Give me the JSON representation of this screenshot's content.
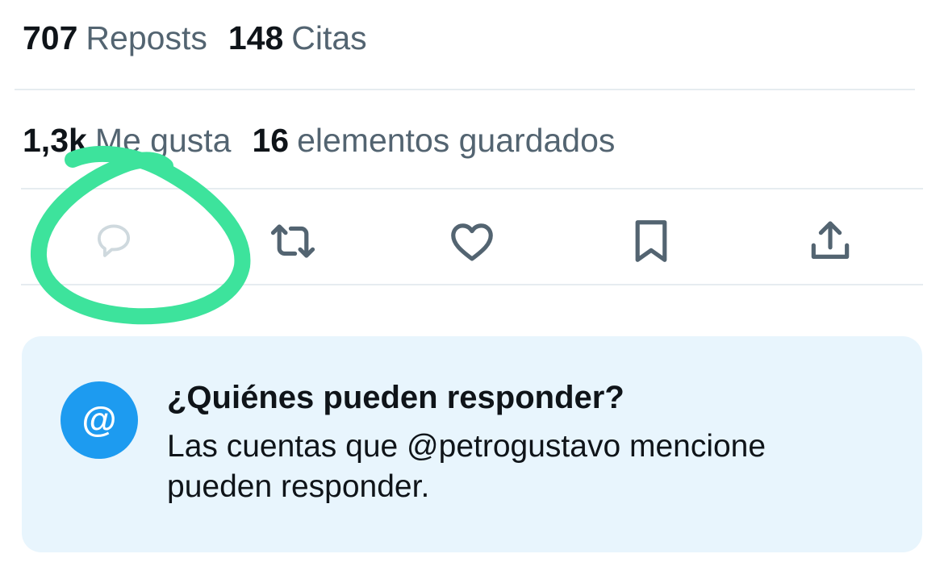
{
  "stats": {
    "reposts": {
      "count": "707",
      "label": "Reposts"
    },
    "quotes": {
      "count": "148",
      "label": "Citas"
    },
    "likes": {
      "count": "1,3k",
      "label": "Me gusta"
    },
    "bookmarks": {
      "count": "16",
      "label": "elementos guardados"
    }
  },
  "actions": [
    {
      "icon": "reply-icon"
    },
    {
      "icon": "repost-icon"
    },
    {
      "icon": "heart-icon"
    },
    {
      "icon": "bookmark-icon"
    },
    {
      "icon": "share-icon"
    }
  ],
  "reply_notice": {
    "icon_glyph": "@",
    "title": "¿Quiénes pueden responder?",
    "body": "Las cuentas que @petrogustavo mencione pueden responder."
  },
  "colors": {
    "icon": "#536471",
    "reply_icon_disabled": "#cfd9de",
    "annotation": "#3de39c",
    "accent": "#1d9bf0",
    "notice_background": "#e8f5fd",
    "divider": "#e6ecf0"
  }
}
